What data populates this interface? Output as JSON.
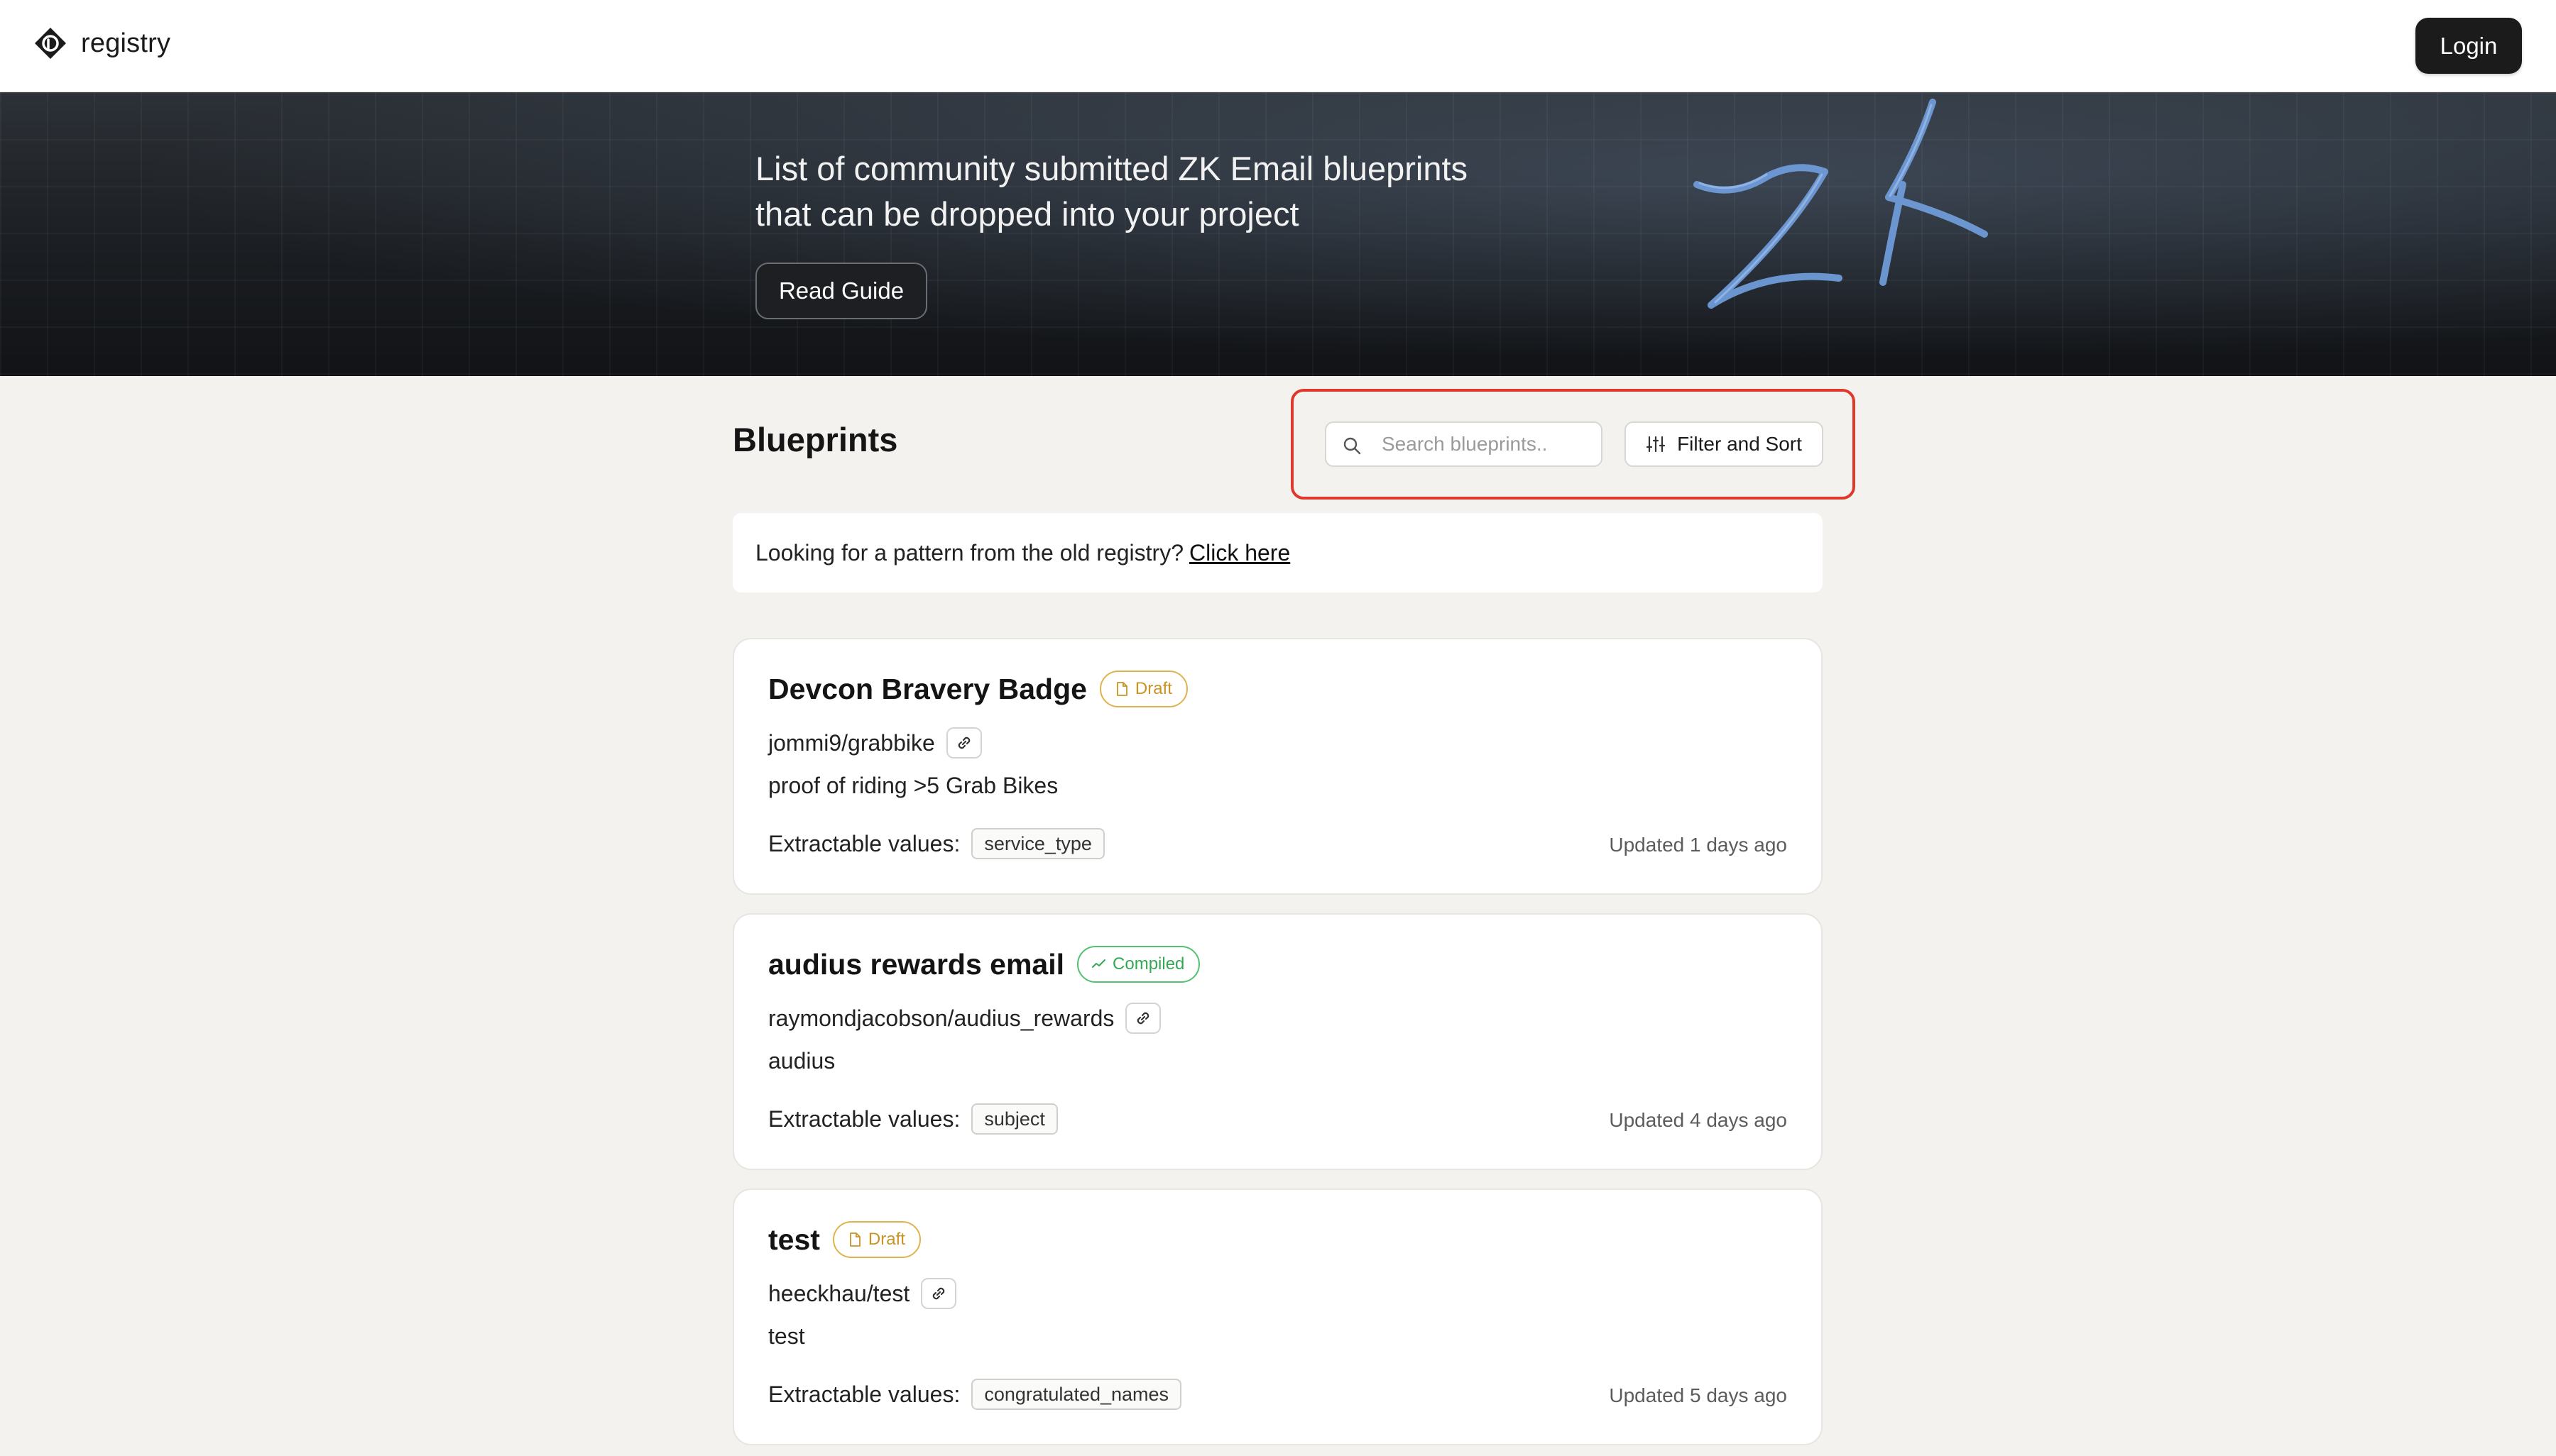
{
  "header": {
    "brand_name": "registry",
    "login_label": "Login"
  },
  "hero": {
    "title_line1": "List of community submitted ZK Email blueprints",
    "title_line2": "that can be dropped into your project",
    "read_guide_label": "Read Guide",
    "art_text": "ZK"
  },
  "blueprints": {
    "title": "Blueprints",
    "search_placeholder": "Search blueprints..",
    "filter_label": "Filter and Sort"
  },
  "notice": {
    "text": "Looking for a pattern from the old registry?",
    "link_text": "Click here"
  },
  "cards": [
    {
      "title": "Devcon Bravery Badge",
      "status": "Draft",
      "path": "jommi9/grabbike",
      "description": "proof of riding >5 Grab Bikes",
      "values_label": "Extractable values:",
      "values": [
        "service_type"
      ],
      "updated": "Updated 1 days ago"
    },
    {
      "title": "audius rewards email",
      "status": "Compiled",
      "path": "raymondjacobson/audius_rewards",
      "description": "audius",
      "values_label": "Extractable values:",
      "values": [
        "subject"
      ],
      "updated": "Updated 4 days ago"
    },
    {
      "title": "test",
      "status": "Draft",
      "path": "heeckhau/test",
      "description": "test",
      "values_label": "Extractable values:",
      "values": [
        "congratulated_names"
      ],
      "updated": "Updated 5 days ago"
    }
  ],
  "colors": {
    "highlight": "#e0392c",
    "draft": "#c99324",
    "compiled": "#33a855",
    "zk_art": "#6f9bd8"
  },
  "icons": {
    "brand": "registry-logo-icon",
    "search": "search-icon",
    "filter": "sliders-icon",
    "draft": "document-icon",
    "compiled": "check-trend-icon",
    "link": "link-icon"
  }
}
